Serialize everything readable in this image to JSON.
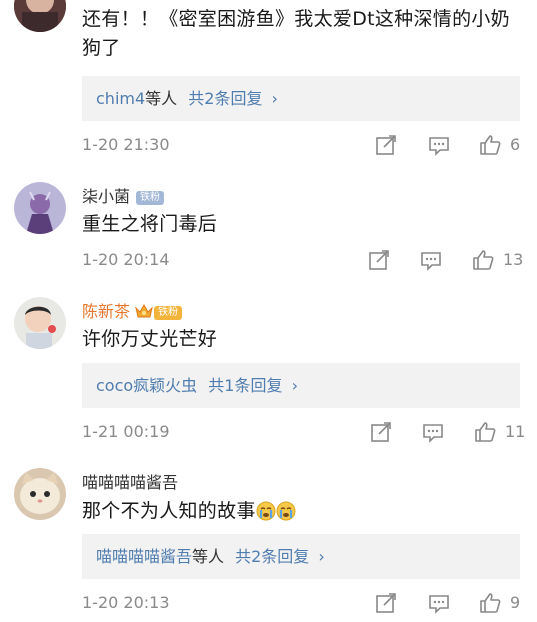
{
  "comments": [
    {
      "name": "",
      "text": "还有！！《密室困游鱼》我太爱Dt这种深情的小奶狗了",
      "reply": {
        "names": "chim4",
        "suffix": "等人",
        "count_text": "共2条回复",
        "arrow": "›"
      },
      "time": "1-20 21:30",
      "likes": "6"
    },
    {
      "name": "柒小菌",
      "badge": "铁粉",
      "text": "重生之将门毒后",
      "time": "1-20 20:14",
      "likes": "13"
    },
    {
      "name": "陈新茶",
      "badge": "铁粉",
      "text": "许你万丈光芒好",
      "reply": {
        "names": "coco疯颖火虫",
        "suffix": "",
        "count_text": "共1条回复",
        "arrow": "›"
      },
      "time": "1-21 00:19",
      "likes": "11"
    },
    {
      "name": "喵喵喵喵酱吾",
      "text": "那个不为人知的故事",
      "reply": {
        "names": "喵喵喵喵酱吾",
        "suffix": "等人",
        "count_text": "共2条回复",
        "arrow": "›"
      },
      "time": "1-20 20:13",
      "likes": "9"
    }
  ],
  "icons": {
    "share": "share-icon",
    "comment": "comment-icon",
    "like": "thumbs-up-icon",
    "crown": "crown-icon",
    "emoji": "crying-emoji-icon"
  },
  "colors": {
    "link": "#507daf",
    "name_orange": "#e8772e",
    "meta_gray": "#8a8a8a",
    "badge_blue": "#a3b7d6",
    "badge_gold": "#f3b43c"
  }
}
